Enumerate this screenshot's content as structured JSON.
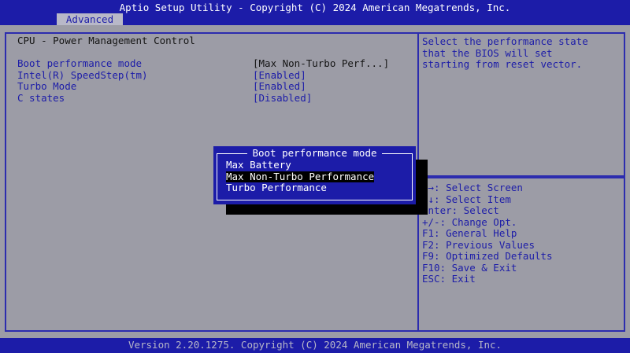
{
  "header": {
    "title": "Aptio Setup Utility - Copyright (C) 2024 American Megatrends, Inc.",
    "active_tab": "Advanced"
  },
  "main": {
    "section_title": "CPU - Power Management Control",
    "options": [
      {
        "label": "Boot performance mode",
        "value": "[Max Non-Turbo Perf...]"
      },
      {
        "label": "Intel(R) SpeedStep(tm)",
        "value": "[Enabled]"
      },
      {
        "label": "Turbo Mode",
        "value": "[Enabled]"
      },
      {
        "label": "C states",
        "value": "[Disabled]"
      }
    ]
  },
  "help": {
    "lines": [
      "Select the performance state",
      "that the BIOS will set",
      "starting from reset vector."
    ]
  },
  "keys": [
    "←→: Select Screen",
    "↑↓: Select Item",
    "Enter: Select",
    "+/-: Change Opt.",
    "F1: General Help",
    "F2: Previous Values",
    "F9: Optimized Defaults",
    "F10: Save & Exit",
    "ESC: Exit"
  ],
  "popup": {
    "title": "Boot performance mode",
    "items": [
      "Max Battery",
      "Max Non-Turbo Performance",
      "Turbo Performance"
    ],
    "selected_index": 1
  },
  "footer": {
    "text": "Version 2.20.1275. Copyright (C) 2024 American Megatrends, Inc."
  },
  "colors": {
    "bios_blue": "#1c1ca8",
    "panel_gray": "#9c9ca6",
    "tab_bg": "#b8b8c8",
    "text_dark": "#141414",
    "highlight_bg": "#000000"
  }
}
